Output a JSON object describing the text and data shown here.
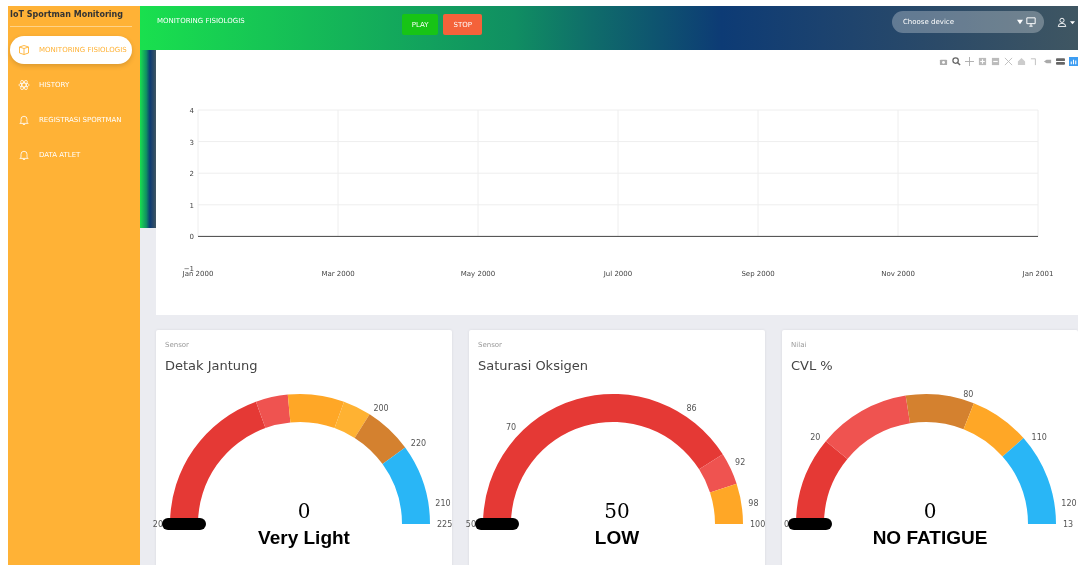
{
  "sidebar": {
    "title": "IoT Sportman Monitoring",
    "items": [
      {
        "label": "MONITORING FISIOLOGIS",
        "selected": true
      },
      {
        "label": "HISTORY",
        "selected": false
      },
      {
        "label": "REGISTRASI SPORTMAN",
        "selected": false
      },
      {
        "label": "DATA ATLET",
        "selected": false
      }
    ]
  },
  "header": {
    "title": "MONITORING FISIOLOGIS",
    "buttons": [
      {
        "label": "PLAY",
        "color": "#17c416"
      },
      {
        "label": "STOP",
        "color": "#f4623a"
      }
    ],
    "device_select": {
      "label": "Choose device"
    }
  },
  "chart": {
    "chart_data": {
      "type": "line",
      "categories": [
        "Jan 2000",
        "Mar 2000",
        "May 2000",
        "Jul 2000",
        "Sep 2000",
        "Nov 2000",
        "Jan 2001"
      ],
      "yticks": [
        {
          "value": -1,
          "label": "−1"
        },
        0,
        1,
        2,
        3,
        4
      ],
      "ylim": [
        -1,
        4
      ],
      "grid": true
    }
  },
  "gauges": [
    {
      "caption": "Sensor",
      "title": "Detak Jantung",
      "value": "0",
      "status": "Very Light",
      "segments": [
        {
          "color": "#e53935"
        },
        {
          "color": "#ef5350"
        },
        {
          "color": "#ffa726"
        },
        {
          "color": "#ffb232"
        },
        {
          "color": "#d4812f"
        },
        {
          "color": "#29b6f6"
        }
      ],
      "ticks": [
        "20",
        "200",
        "220",
        "210",
        "225"
      ]
    },
    {
      "caption": "Sensor",
      "title": "Saturasi Oksigen",
      "value": "50",
      "status": "LOW",
      "segments": [
        {
          "color": "#e53935"
        },
        {
          "color": "#ef5350"
        },
        {
          "color": "#ffa726"
        }
      ],
      "ticks": [
        "50",
        "70",
        "86",
        "92",
        "98",
        "100"
      ]
    },
    {
      "caption": "Nilai",
      "title": "CVL %",
      "value": "0",
      "status": "NO FATIGUE",
      "segments": [
        {
          "color": "#e53935"
        },
        {
          "color": "#ef5350"
        },
        {
          "color": "#d4812f"
        },
        {
          "color": "#ffa726"
        },
        {
          "color": "#29b6f6"
        }
      ],
      "ticks": [
        "0",
        "20",
        "80",
        "110",
        "120",
        "13"
      ]
    }
  ]
}
